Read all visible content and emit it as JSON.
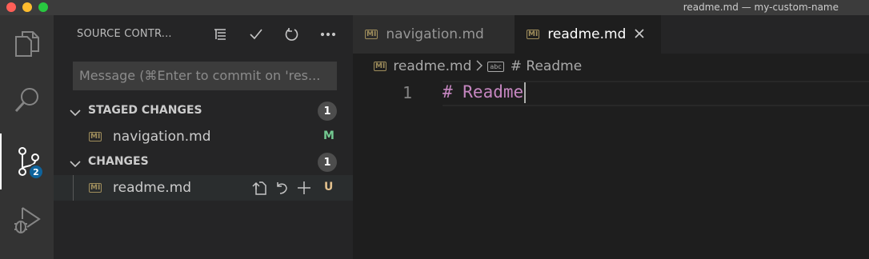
{
  "window": {
    "title": "readme.md — my-custom-name"
  },
  "activity_bar": {
    "scm_badge": "2"
  },
  "sidebar": {
    "header": "SOURCE CONTR...",
    "commit_placeholder": "Message (⌘Enter to commit on 'res...",
    "staged": {
      "label": "STAGED CHANGES",
      "count": "1",
      "files": [
        {
          "name": "navigation.md",
          "status": "M",
          "icon": "MI"
        }
      ]
    },
    "changes": {
      "label": "CHANGES",
      "count": "1",
      "files": [
        {
          "name": "readme.md",
          "status": "U",
          "icon": "MI"
        }
      ]
    }
  },
  "tabs": [
    {
      "label": "navigation.md",
      "icon": "MI"
    },
    {
      "label": "readme.md",
      "icon": "MI"
    }
  ],
  "breadcrumb": {
    "file": "readme.md",
    "symbol_icon": "abc",
    "symbol": "# Readme",
    "file_icon": "MI"
  },
  "editor": {
    "line_number": "1",
    "line_text": "# Readme"
  },
  "colors": {
    "accent": "#0e639c",
    "modified": "#73c991",
    "untracked": "#e2c08d",
    "heading": "#c586c0"
  }
}
